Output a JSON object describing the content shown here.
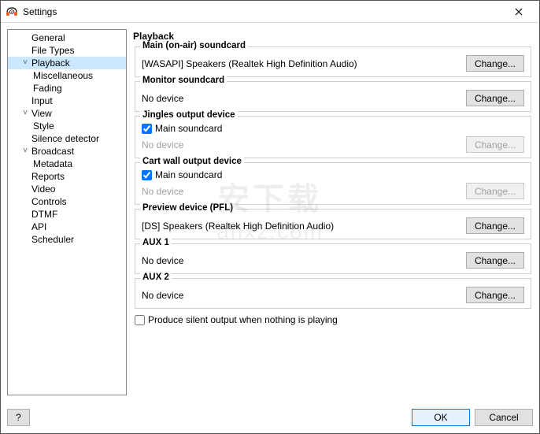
{
  "window": {
    "title": "Settings"
  },
  "sidebar": {
    "items": [
      {
        "label": "General",
        "depth": 1,
        "arrow": ""
      },
      {
        "label": "File Types",
        "depth": 1,
        "arrow": ""
      },
      {
        "label": "Playback",
        "depth": 1,
        "arrow": "v",
        "selected": true
      },
      {
        "label": "Miscellaneous",
        "depth": 2,
        "arrow": ""
      },
      {
        "label": "Fading",
        "depth": 2,
        "arrow": ""
      },
      {
        "label": "Input",
        "depth": 1,
        "arrow": ""
      },
      {
        "label": "View",
        "depth": 1,
        "arrow": "v"
      },
      {
        "label": "Style",
        "depth": 2,
        "arrow": ""
      },
      {
        "label": "Silence detector",
        "depth": 1,
        "arrow": ""
      },
      {
        "label": "Broadcast",
        "depth": 1,
        "arrow": "v"
      },
      {
        "label": "Metadata",
        "depth": 2,
        "arrow": ""
      },
      {
        "label": "Reports",
        "depth": 1,
        "arrow": ""
      },
      {
        "label": "Video",
        "depth": 1,
        "arrow": ""
      },
      {
        "label": "Controls",
        "depth": 1,
        "arrow": ""
      },
      {
        "label": "DTMF",
        "depth": 1,
        "arrow": ""
      },
      {
        "label": "API",
        "depth": 1,
        "arrow": ""
      },
      {
        "label": "Scheduler",
        "depth": 1,
        "arrow": ""
      }
    ]
  },
  "panel": {
    "heading": "Playback",
    "change_label": "Change...",
    "groups": {
      "main": {
        "legend": "Main (on-air) soundcard",
        "value": "[WASAPI] Speakers (Realtek High Definition Audio)"
      },
      "monitor": {
        "legend": "Monitor soundcard",
        "value": "No device"
      },
      "jingles": {
        "legend": "Jingles output device",
        "check": "Main soundcard",
        "value": "No device"
      },
      "cartwall": {
        "legend": "Cart wall output device",
        "check": "Main soundcard",
        "value": "No device"
      },
      "preview": {
        "legend": "Preview device (PFL)",
        "value": "[DS] Speakers (Realtek High Definition Audio)"
      },
      "aux1": {
        "legend": "AUX 1",
        "value": "No device"
      },
      "aux2": {
        "legend": "AUX 2",
        "value": "No device"
      }
    },
    "silent_output_label": "Produce silent output when nothing is playing"
  },
  "footer": {
    "help": "?",
    "ok": "OK",
    "cancel": "Cancel"
  },
  "watermark": {
    "ch": "安下载",
    "en": "anxz.com"
  }
}
